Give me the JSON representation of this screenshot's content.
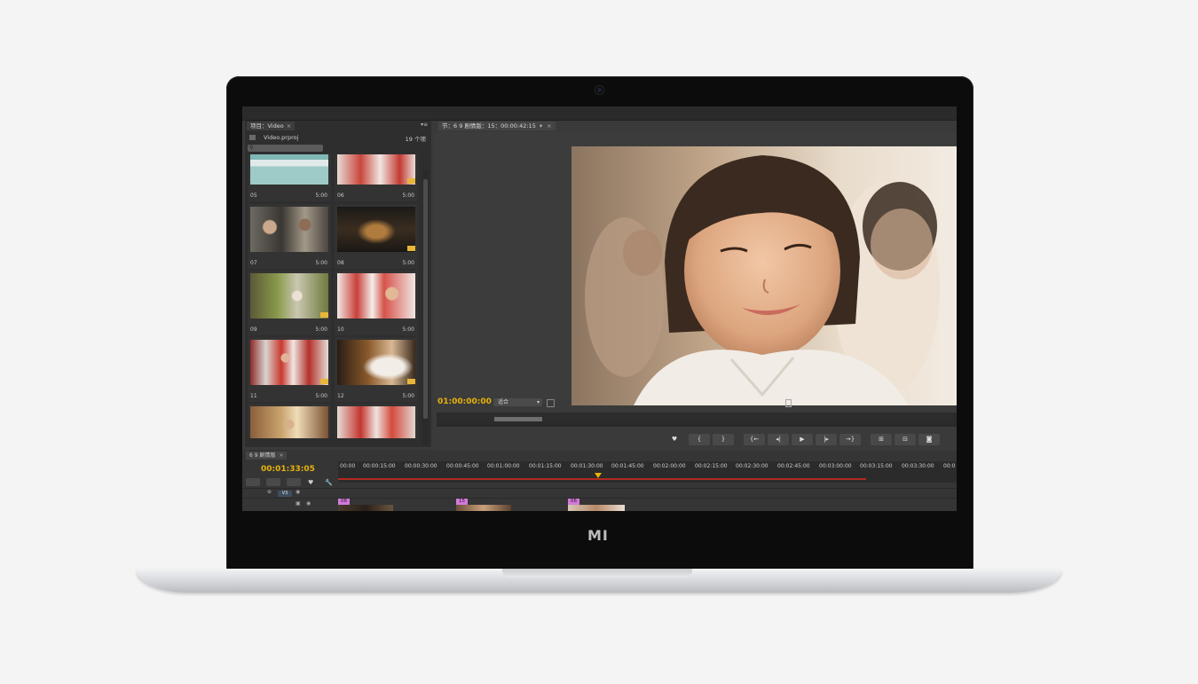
{
  "device": {
    "logo": "MI"
  },
  "project_panel": {
    "tab_label": "项目：Video",
    "tab_close": "×",
    "menu_glyph": "▾≡",
    "file_name": "Video.prproj",
    "item_count": "19 个项",
    "search_icon_glyph": "⚲",
    "items": [
      {
        "num": "05",
        "duration": "5:00",
        "badge": false
      },
      {
        "num": "06",
        "duration": "5:00",
        "badge": true
      },
      {
        "num": "07",
        "duration": "5:00",
        "badge": false
      },
      {
        "num": "08",
        "duration": "5:00",
        "badge": true
      },
      {
        "num": "09",
        "duration": "5:00",
        "badge": true
      },
      {
        "num": "10",
        "duration": "5:00",
        "badge": false
      },
      {
        "num": "11",
        "duration": "5:00",
        "badge": true
      },
      {
        "num": "12",
        "duration": "5:00",
        "badge": true
      },
      {
        "num": "",
        "duration": "",
        "badge": false
      },
      {
        "num": "",
        "duration": "",
        "badge": false
      }
    ]
  },
  "program_monitor": {
    "tab_label": "节：6 9 剧情版：15：00:00:42:15",
    "tab_caret": "▾",
    "tab_close": "×",
    "timecode": "01:00:00:00",
    "fit_label": "适合",
    "fit_caret": "▾",
    "controls": [
      "♥",
      "{",
      "}",
      "{←",
      "◂|",
      "▶",
      "|▸",
      "→}",
      "⊞",
      "⊟",
      "◙"
    ]
  },
  "timeline": {
    "tab_label": "6 9 剧情版",
    "tab_close": "×",
    "timecode": "00:01:33:05",
    "ticks": [
      "00:00",
      "00:00:15:00",
      "00:00:30:00",
      "00:00:45:00",
      "00:01:00:00",
      "00:01:15:00",
      "00:01:30:00",
      "00:01:45:00",
      "00:02:00:00",
      "00:02:15:00",
      "00:02:30:00",
      "00:02:45:00",
      "00:03:00:00",
      "00:03:15:00",
      "00:03:30:00",
      "00:0"
    ],
    "track_label": "V3",
    "tool_glyphs": [
      "♥",
      "🔧"
    ],
    "clips": [
      {
        "label": "08"
      },
      {
        "label": "15"
      },
      {
        "label": "06"
      }
    ],
    "colors": {
      "timecode": "#e7b30b",
      "work_area": "#b02a20",
      "clip_label": "#d27ad8"
    }
  }
}
